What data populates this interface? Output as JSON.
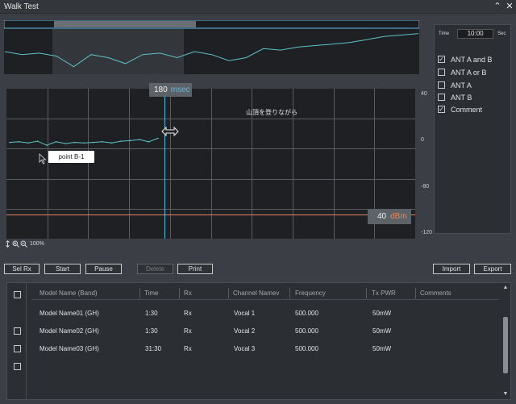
{
  "window": {
    "title": "Walk Test"
  },
  "chart": {
    "time_value": "180",
    "time_unit": "msec",
    "level_value": "40",
    "level_unit": "dBm",
    "note": "山頂を登りながら",
    "callout": "point B-1",
    "y_ticks": [
      "40",
      "0",
      "-80",
      "-120"
    ],
    "zoom_level": "100%",
    "colors": {
      "trace": "#5fc3c7",
      "cursor": "#5fb8e2",
      "level": "#e2875c"
    }
  },
  "chart_data": {
    "type": "line",
    "y_ticks": [
      40,
      0,
      -80,
      -120
    ],
    "marker_time_msec": 180,
    "reference_level_dbm": 40,
    "series": [
      {
        "values": [
          -5,
          -4,
          -6,
          -3,
          -10,
          -4,
          -7,
          -5,
          -6,
          -5,
          -4,
          -6,
          -3,
          -2,
          0,
          -4,
          1
        ]
      }
    ]
  },
  "overview_data": {
    "values": [
      -20,
      -22,
      -21,
      -23,
      -30,
      -22,
      -24,
      -28,
      -22,
      -21,
      -24,
      -20,
      -22,
      -26,
      -24,
      -18,
      -19,
      -17,
      -16,
      -15,
      -14,
      -12,
      -10,
      -9,
      -8
    ]
  },
  "side_panel": {
    "time_label": "Time",
    "time_value": "10:00",
    "time_unit": "Sec",
    "options": [
      {
        "label": "ANT A and B",
        "checked": true
      },
      {
        "label": "ANT A or B",
        "checked": false
      },
      {
        "label": "ANT A",
        "checked": false
      },
      {
        "label": "ANT B",
        "checked": false
      },
      {
        "label": "Comment",
        "checked": true
      }
    ]
  },
  "buttons": {
    "sel_rx": "Sel Rx",
    "start": "Start",
    "pause": "Pause",
    "delete": "Delete",
    "print": "Print",
    "import": "Import",
    "export": "Export"
  },
  "table": {
    "columns": [
      "Model Name (Band)",
      "Time",
      "Rx",
      "Channel Namev",
      "Frequency",
      "Tx PWR",
      "Comments"
    ],
    "rows": [
      [
        "Model Name01 (GH)",
        "1:30",
        "Rx",
        "Vocal 1",
        "500.000",
        "50mW",
        ""
      ],
      [
        "Model Name02 (GH)",
        "1:30",
        "Rx",
        "Vocal 2",
        "500.000",
        "50mW",
        ""
      ],
      [
        "Model Name03 (GH)",
        "31:30",
        "Rx",
        "Vocal 3",
        "500.000",
        "50mW",
        ""
      ]
    ]
  }
}
